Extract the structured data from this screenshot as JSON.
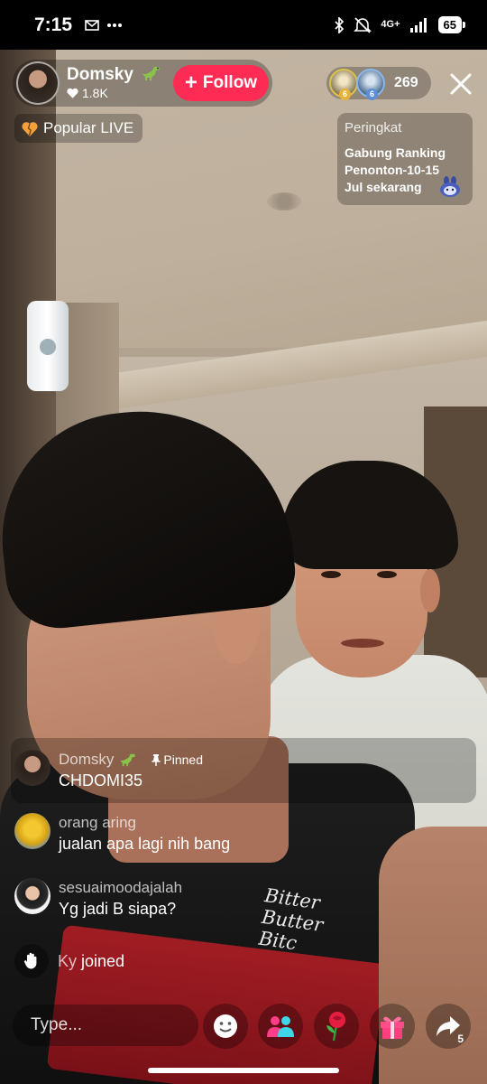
{
  "status_bar": {
    "time": "7:15",
    "left_icons": [
      "mail-icon",
      "more-icon"
    ],
    "network": "4G+",
    "battery": "65",
    "right_icons": [
      "bluetooth-icon",
      "mute-icon",
      "signal-icon",
      "battery-icon"
    ]
  },
  "host": {
    "name": "Domsky",
    "badge_icon": "dinosaur-icon",
    "likes": "1.8K",
    "follow_label": "Follow"
  },
  "viewers": {
    "top": [
      {
        "rank": "6",
        "color": "#e5b339"
      },
      {
        "rank": "6",
        "color": "#5c8fd6"
      }
    ],
    "count": "269"
  },
  "popular_label": "Popular LIVE",
  "ranking": {
    "title": "Peringkat",
    "text": "Gabung Ranking Penonton-10-15 Jul sekarang"
  },
  "pinned": {
    "name": "Domsky",
    "tag": "Pinned",
    "text": "CHDOMI35"
  },
  "comments": [
    {
      "name": "orang aring",
      "text": "jualan apa lagi nih bang"
    },
    {
      "name": "sesuaimoodajalah",
      "text": "Yg jadi B siapa?"
    }
  ],
  "joined": {
    "user": "Ky",
    "text": "joined"
  },
  "bottom": {
    "input_placeholder": "Type...",
    "share_count": "5",
    "buttons": [
      "emoji-icon",
      "multi-guest-icon",
      "rose-gift-icon",
      "gift-box-icon",
      "share-icon"
    ]
  },
  "video_shirt_text": "Bitter Butter Bitc",
  "colors": {
    "follow": "#fe2c55",
    "popular_heart": "#f4a03a"
  }
}
